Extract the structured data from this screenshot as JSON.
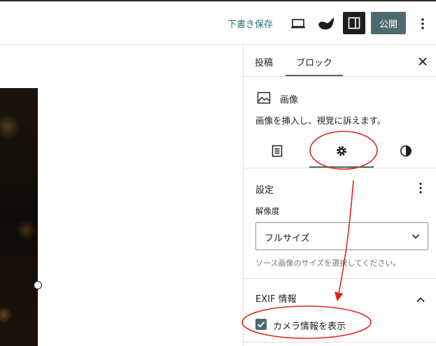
{
  "toolbar": {
    "save_draft": "下書き保存",
    "publish": "公開"
  },
  "sidebar": {
    "tabs": [
      "投稿",
      "ブロック"
    ],
    "block": {
      "title": "画像",
      "description": "画像を挿入し、視覚に訴えます。"
    },
    "settings": {
      "title": "設定",
      "resolution_label": "解像度",
      "resolution_value": "フルサイズ",
      "resolution_help": "ソース画像のサイズを選択してください。"
    },
    "exif": {
      "title": "EXIF 情報",
      "camera_info_label": "カメラ情報を表示",
      "camera_info_checked": true
    }
  },
  "colors": {
    "accent": "#4e6a6d",
    "draft_link": "#2f6f73",
    "annotation_red": "#e0261b"
  },
  "icons": [
    "laptop-icon",
    "site-icon",
    "sidebar-toggle-icon",
    "more-vertical-icon",
    "close-icon",
    "image-icon",
    "list-view-icon",
    "settings-gear-icon",
    "styles-contrast-icon",
    "chevron-down-icon",
    "chevron-up-icon",
    "check-icon"
  ]
}
